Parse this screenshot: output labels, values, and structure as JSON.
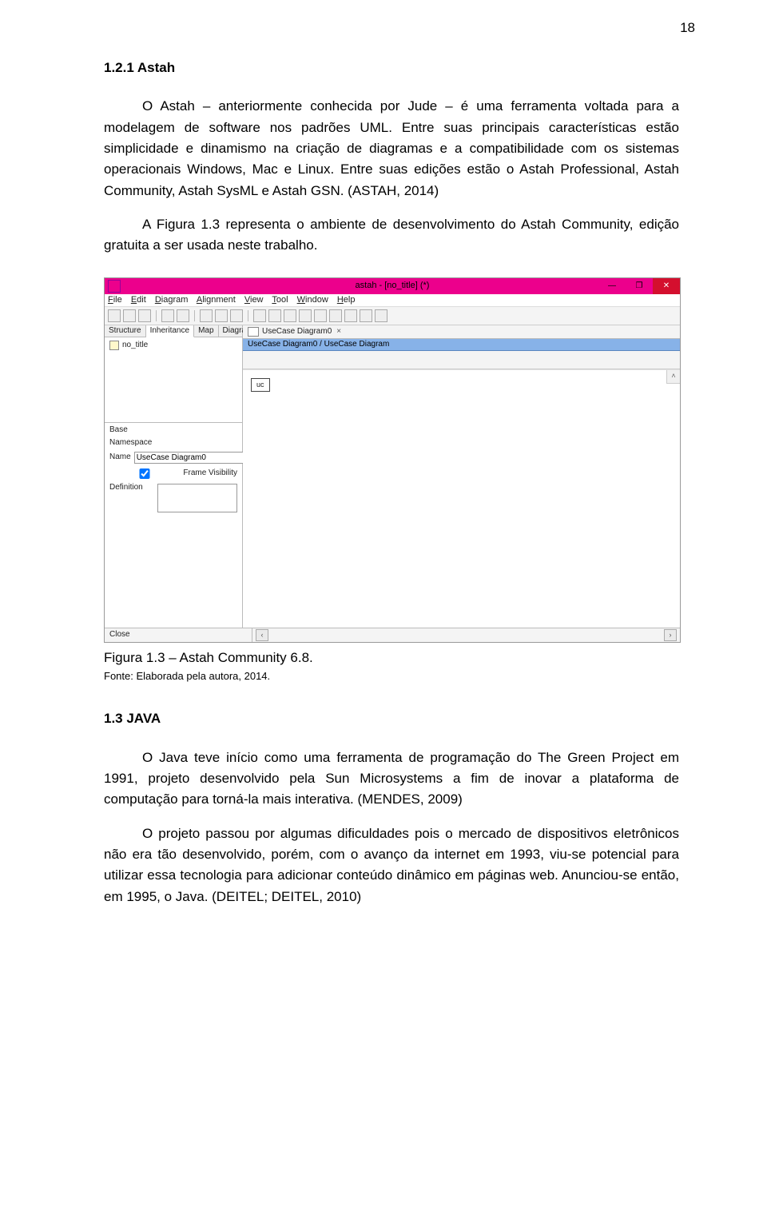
{
  "page_number": "18",
  "section_heading_1": "1.2.1 Astah",
  "para1": "O Astah – anteriormente conhecida por Jude – é uma ferramenta voltada para a modelagem de software nos padrões UML. Entre suas principais características estão simplicidade e dinamismo na criação de diagramas e a compatibilidade com os sistemas operacionais Windows, Mac e Linux. Entre suas edições estão o Astah Professional, Astah Community, Astah SysML e Astah GSN. (ASTAH, 2014)",
  "para2": "A Figura 1.3 representa o ambiente de desenvolvimento do Astah Community, edição gratuita a ser usada neste trabalho.",
  "figure_caption": "Figura 1.3 – Astah Community 6.8.",
  "figure_source": "Fonte: Elaborada pela autora, 2014.",
  "section_heading_2": "1.3 JAVA",
  "para3": "O Java teve início como uma ferramenta de programação do The Green Project em 1991, projeto desenvolvido pela Sun Microsystems a fim de inovar a plataforma de computação para torná-la mais interativa. (MENDES, 2009)",
  "para4": "O projeto passou por algumas dificuldades pois o mercado de dispositivos eletrônicos não era tão desenvolvido, porém, com o avanço da internet em 1993, viu-se potencial para utilizar essa tecnologia para adicionar conteúdo dinâmico em páginas web. Anunciou-se então, em 1995, o Java. (DEITEL; DEITEL, 2010)",
  "astah": {
    "window_title": "astah - [no_title] (*)",
    "menu_file": "File",
    "menu_edit": "Edit",
    "menu_diagram": "Diagram",
    "menu_alignment": "Alignment",
    "menu_view": "View",
    "menu_tool": "Tool",
    "menu_window": "Window",
    "menu_help": "Help",
    "left_tab_structure": "Structure",
    "left_tab_inheritance": "Inheritance",
    "left_tab_map": "Map",
    "left_tab_diagram": "Diagram",
    "tree_node": "no_title",
    "prop_base": "Base",
    "prop_namespace": "Namespace",
    "prop_name": "Name",
    "prop_name_value": "UseCase Diagram0",
    "prop_frame": "Frame Visibility",
    "prop_definition": "Definition",
    "doc_tab": "UseCase Diagram0",
    "breadcrumb": "UseCase Diagram0 / UseCase Diagram",
    "canvas_box": "uc",
    "status_close": "Close"
  }
}
